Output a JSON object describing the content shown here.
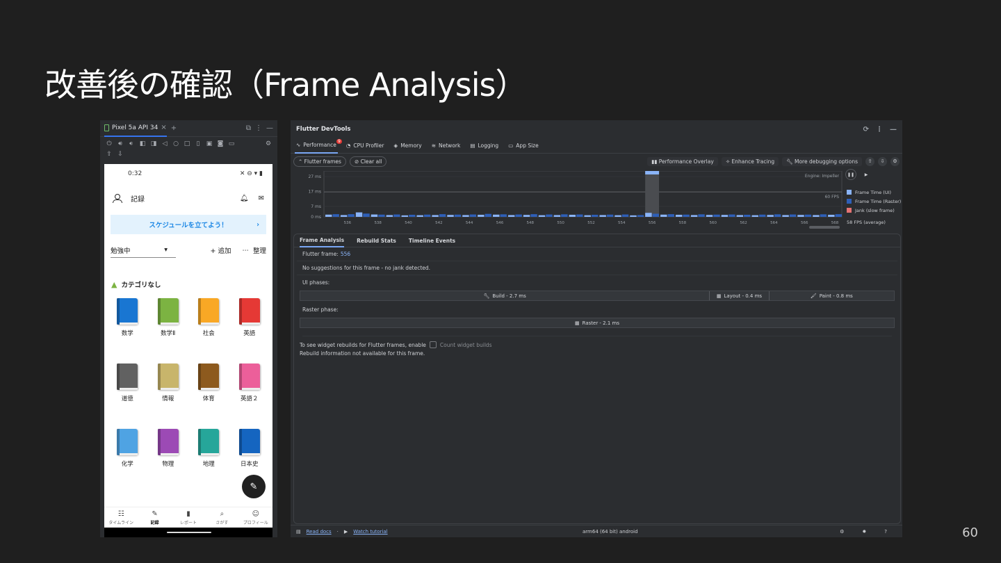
{
  "slide": {
    "title": "改善後の確認（Frame Analysis）",
    "page_number": "60"
  },
  "emulator": {
    "tab_label": "Pixel 5a API 34",
    "phone": {
      "status_time": "0:32",
      "header_title": "記録",
      "banner": "スケジュールを立てよう！",
      "filter_value": "勉強中",
      "add_label": "+ 追加",
      "organize_label": "整理",
      "category": "カテゴリなし",
      "books": [
        {
          "label": "数学",
          "color": "#1976d2"
        },
        {
          "label": "数学Ⅱ",
          "color": "#7cb342"
        },
        {
          "label": "社会",
          "color": "#f9a825"
        },
        {
          "label": "英語",
          "color": "#e53935"
        },
        {
          "label": "道徳",
          "color": "#616161"
        },
        {
          "label": "情報",
          "color": "#c8b56b"
        },
        {
          "label": "体育",
          "color": "#8d5a1e"
        },
        {
          "label": "英語２",
          "color": "#ec5f9a"
        },
        {
          "label": "化学",
          "color": "#4fa3e3"
        },
        {
          "label": "物理",
          "color": "#9c4ab5"
        },
        {
          "label": "地理",
          "color": "#26a69a"
        },
        {
          "label": "日本史",
          "color": "#1565c0"
        }
      ],
      "nav": [
        "タイムライン",
        "記録",
        "レポート",
        "さがす",
        "プロフィール"
      ]
    }
  },
  "devtools": {
    "title": "Flutter DevTools",
    "tabs": [
      {
        "label": "Performance",
        "badge": "9",
        "icon": "performance-icon"
      },
      {
        "label": "CPU Profiler",
        "icon": "cpu-icon"
      },
      {
        "label": "Memory",
        "icon": "memory-icon"
      },
      {
        "label": "Network",
        "icon": "network-icon"
      },
      {
        "label": "Logging",
        "icon": "logging-icon"
      },
      {
        "label": "App Size",
        "icon": "app-size-icon"
      }
    ],
    "controls": {
      "flutter_frames": "Flutter frames",
      "clear_all": "Clear all",
      "performance_overlay": "Performance Overlay",
      "enhance_tracing": "Enhance Tracing",
      "more_debugging": "More debugging options"
    },
    "chart": {
      "engine_label": "Engine: Impeller",
      "fps_line_label": "60 FPS",
      "y_ticks": [
        "27 ms",
        "17 ms",
        "7 ms",
        "0 ms"
      ],
      "x_ticks": [
        "536",
        "538",
        "540",
        "542",
        "544",
        "546",
        "548",
        "550",
        "552",
        "554",
        "556",
        "558",
        "560",
        "562",
        "564",
        "566",
        "568"
      ],
      "legend": [
        "Frame Time (UI)",
        "Frame Time (Raster)",
        "Jank (slow frame)"
      ],
      "fps_average": "58 FPS (average)"
    },
    "chart_data": {
      "type": "bar",
      "title": "",
      "xlabel": "",
      "ylabel": "",
      "ylim": [
        0,
        27
      ],
      "categories": [
        535,
        536,
        537,
        538,
        539,
        540,
        541,
        542,
        543,
        544,
        545,
        546,
        547,
        548,
        549,
        550,
        551,
        552,
        553,
        554,
        555,
        556,
        557,
        558,
        559,
        560,
        561,
        562,
        563,
        564,
        565,
        566,
        567,
        568
      ],
      "series": [
        {
          "name": "Frame Time (UI)",
          "color": "#8ab4f8",
          "values": [
            1.5,
            1.2,
            3.0,
            1.6,
            1.2,
            1.0,
            1.1,
            1.2,
            1.3,
            1.2,
            1.4,
            1.5,
            1.2,
            1.3,
            1.1,
            1.2,
            1.4,
            1.1,
            1.2,
            1.1,
            1.0,
            2.7,
            1.5,
            1.4,
            1.2,
            1.3,
            1.3,
            1.2,
            1.1,
            1.3,
            1.2,
            1.3,
            1.2,
            1.4
          ]
        },
        {
          "name": "Frame Time (Raster)",
          "color": "#2e5fb8",
          "values": [
            1.8,
            1.8,
            2.2,
            1.5,
            1.6,
            1.4,
            1.5,
            1.8,
            1.5,
            1.6,
            2.0,
            1.7,
            1.6,
            1.8,
            1.6,
            1.7,
            1.6,
            1.4,
            1.5,
            1.6,
            1.2,
            2.1,
            1.8,
            1.5,
            1.7,
            1.5,
            1.6,
            1.4,
            1.5,
            1.7,
            1.6,
            1.5,
            1.7,
            1.8
          ]
        }
      ],
      "selected_frame": 556
    },
    "analysis": {
      "tabs": [
        "Frame Analysis",
        "Rebuild Stats",
        "Timeline Events"
      ],
      "flutter_frame_label": "Flutter frame:",
      "flutter_frame_num": "556",
      "suggestion": "No suggestions for this frame - no jank detected.",
      "ui_phases_label": "UI phases:",
      "build": "Build - 2.7 ms",
      "layout": "Layout - 0.4 ms",
      "paint": "Paint - 0.8 ms",
      "raster_label": "Raster phase:",
      "raster": "Raster - 2.1 ms",
      "rebuild_hint": "To see widget rebuilds for Flutter frames, enable",
      "count_widget": "Count widget builds",
      "rebuild_na": "Rebuild information not available for this frame."
    },
    "footer": {
      "read_docs": "Read docs",
      "watch_tutorial": "Watch tutorial",
      "platform": "arm64 (64 bit) android"
    }
  }
}
